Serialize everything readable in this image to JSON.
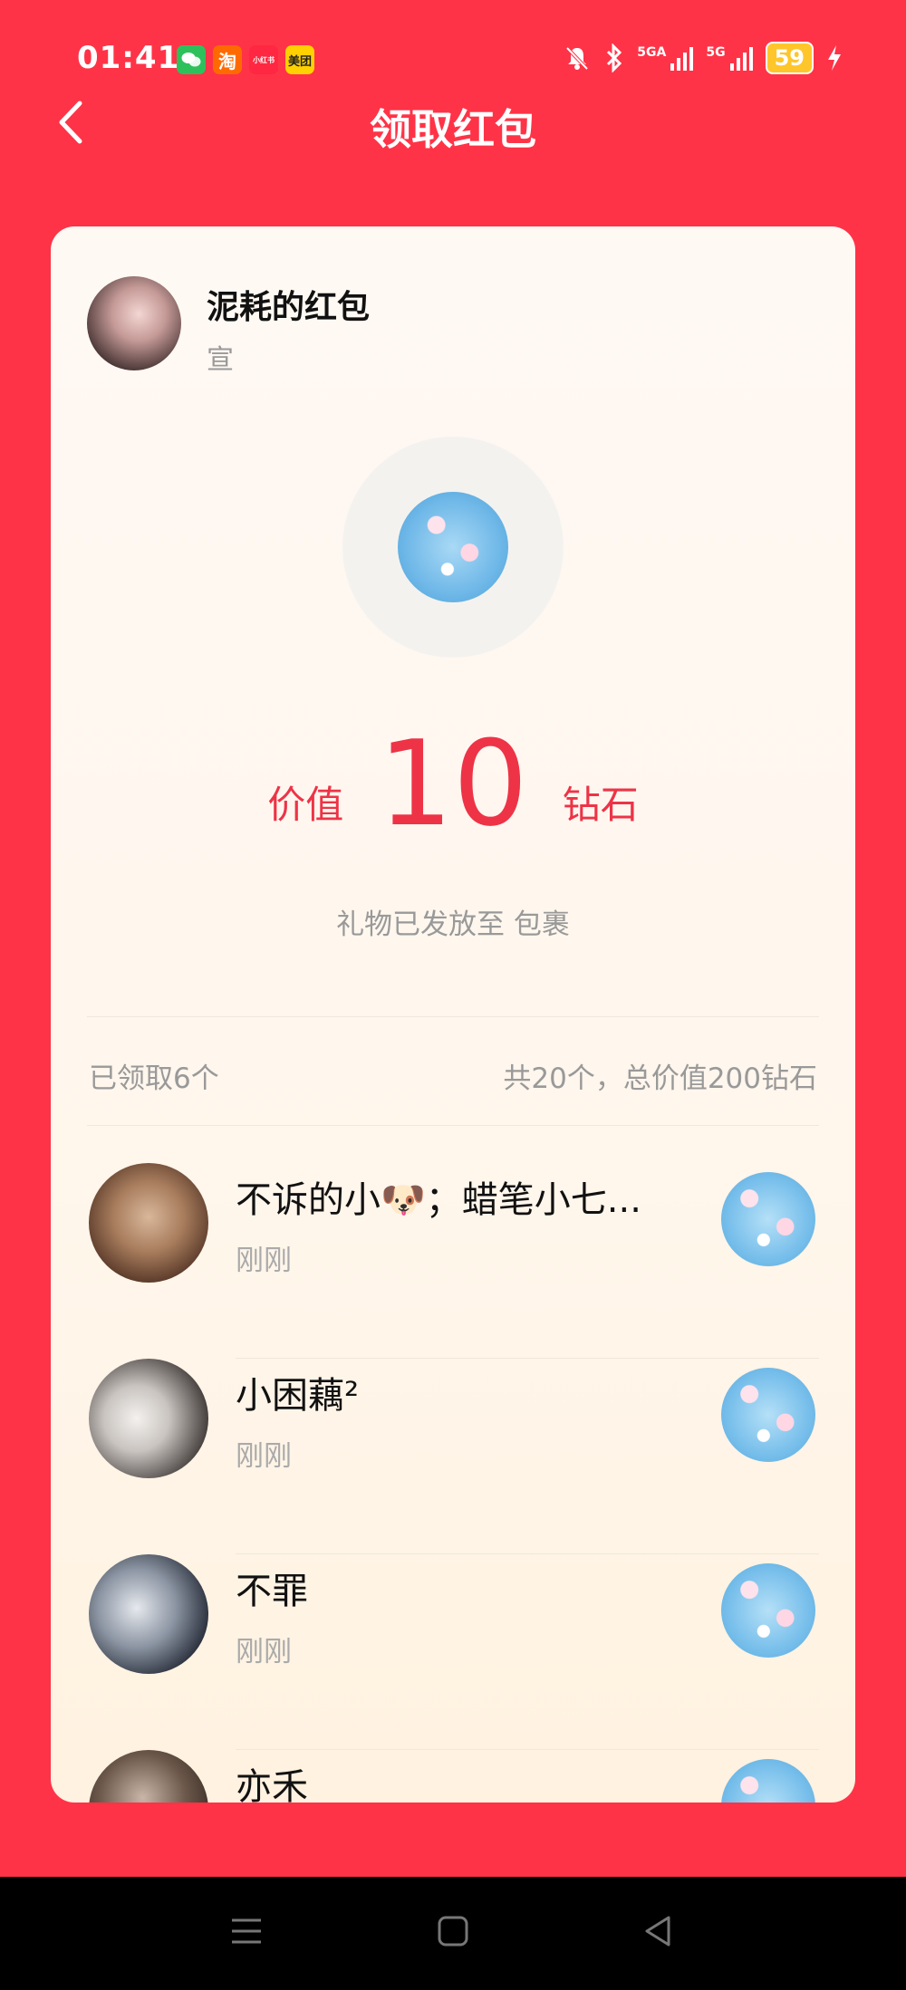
{
  "status_bar": {
    "time": "01:41",
    "app_icons": [
      {
        "name": "wechat-icon",
        "label": "",
        "color": "#2ec15b"
      },
      {
        "name": "taobao-icon",
        "label": "淘",
        "color": "#ff6a00"
      },
      {
        "name": "xiaohongshu-icon",
        "label": "小红书",
        "color": "#ff2741"
      },
      {
        "name": "meituan-icon",
        "label": "美团",
        "color": "#ffd100"
      }
    ],
    "signal_1": "5GA",
    "signal_2": "5G",
    "battery": "59"
  },
  "header": {
    "title": "领取红包"
  },
  "sender": {
    "name": "泥耗的红包",
    "subtitle": "宣"
  },
  "value": {
    "prefix": "价值",
    "amount": "10",
    "unit": "钻石"
  },
  "delivered_text": "礼物已发放至 包裹",
  "summary": {
    "claimed": "已领取6个",
    "total": "共20个，总价值200钻石"
  },
  "recipients": [
    {
      "name": "不诉的小🐶；蜡笔小七...",
      "time": "刚刚"
    },
    {
      "name": "小困藕²",
      "time": "刚刚"
    },
    {
      "name": "不罪",
      "time": "刚刚"
    },
    {
      "name": "亦禾",
      "time": ""
    }
  ],
  "colors": {
    "background": "#ff3347",
    "accent": "#ee3347"
  }
}
